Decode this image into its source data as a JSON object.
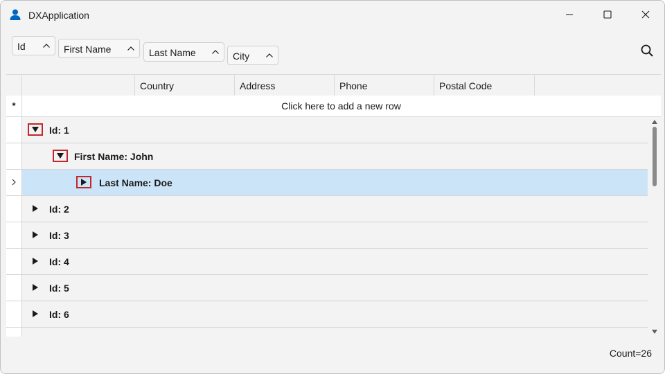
{
  "window": {
    "title": "DXApplication",
    "app_icon": "user-icon",
    "controls": [
      "minimize-icon",
      "maximize-icon",
      "close-icon"
    ]
  },
  "group_panel": {
    "chips": [
      {
        "label": "Id",
        "icon": "chevron-up-icon"
      },
      {
        "label": "First Name",
        "icon": "chevron-up-icon"
      },
      {
        "label": "Last Name",
        "icon": "chevron-up-icon"
      },
      {
        "label": "City",
        "icon": "chevron-up-icon"
      }
    ],
    "search_icon": "search-icon"
  },
  "grid": {
    "columns": [
      "",
      "Country",
      "Address",
      "Phone",
      "Postal Code"
    ],
    "new_row_indicator": "*",
    "new_row_text": "Click here to add a new row",
    "rows": [
      {
        "text": "Id: 1",
        "level": 0,
        "expanded": true,
        "highlighted": true,
        "selected": false
      },
      {
        "text": "First Name: John",
        "level": 1,
        "expanded": true,
        "highlighted": true,
        "selected": false
      },
      {
        "text": "Last Name: Doe",
        "level": 2,
        "expanded": false,
        "highlighted": true,
        "selected": true
      },
      {
        "text": "Id: 2",
        "level": 0,
        "expanded": false,
        "highlighted": false,
        "selected": false
      },
      {
        "text": "Id: 3",
        "level": 0,
        "expanded": false,
        "highlighted": false,
        "selected": false
      },
      {
        "text": "Id: 4",
        "level": 0,
        "expanded": false,
        "highlighted": false,
        "selected": false
      },
      {
        "text": "Id: 5",
        "level": 0,
        "expanded": false,
        "highlighted": false,
        "selected": false
      },
      {
        "text": "Id: 6",
        "level": 0,
        "expanded": false,
        "highlighted": false,
        "selected": false
      }
    ]
  },
  "footer": {
    "count": "Count=26"
  },
  "colors": {
    "background": "#f3f3f3",
    "selected_row": "#cce4f7",
    "highlight_box": "#c1272d",
    "accent": "#0067c0"
  }
}
